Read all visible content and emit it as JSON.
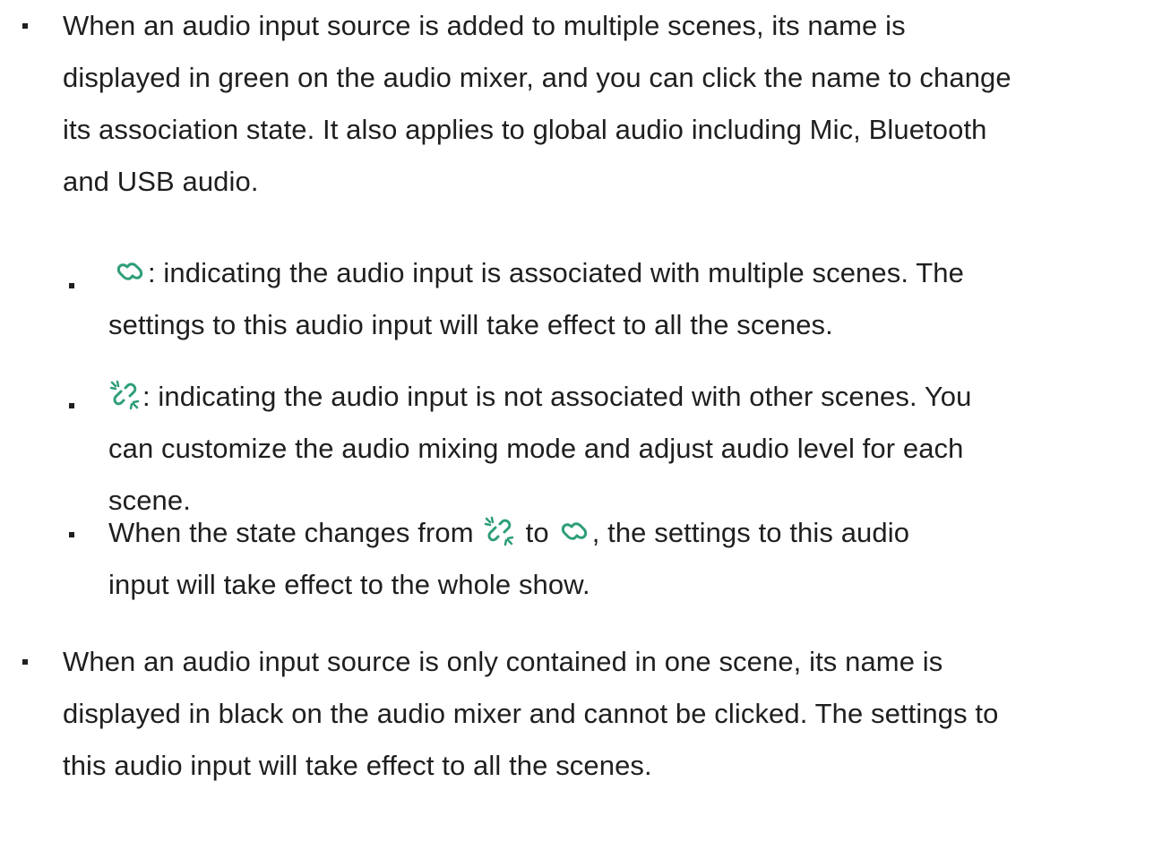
{
  "colors": {
    "text": "#1f1f1f",
    "icon_green": "#2e9e78"
  },
  "icons": {
    "linked": "link-icon",
    "unlinked": "broken-link-icon"
  },
  "items": [
    {
      "lines": [
        "When an audio input source is added to multiple scenes, its name is",
        "displayed in green on the audio mixer, and you can click the name to change",
        "its association state. It also applies to global audio including Mic, Bluetooth",
        "and USB audio."
      ],
      "subitems": [
        {
          "line1_after_icon": ": indicating the audio input is associated with multiple scenes. The",
          "line2": "settings to this audio input will take effect to all the scenes."
        },
        {
          "line1_after_icon": ": indicating the audio input is not associated with other scenes. You",
          "line2": "can customize the audio mixing mode and adjust audio level for each",
          "line3": "scene."
        },
        {
          "line1_before": "When the state changes from",
          "line1_middle": "to",
          "line1_after": ", the settings to this audio",
          "line2": "input will take effect to the whole show."
        }
      ]
    },
    {
      "lines": [
        "When an audio input source is only contained in one scene, its name is",
        "displayed in black on the audio mixer and cannot be clicked. The settings to",
        "this audio input will take effect to all the scenes."
      ]
    }
  ]
}
